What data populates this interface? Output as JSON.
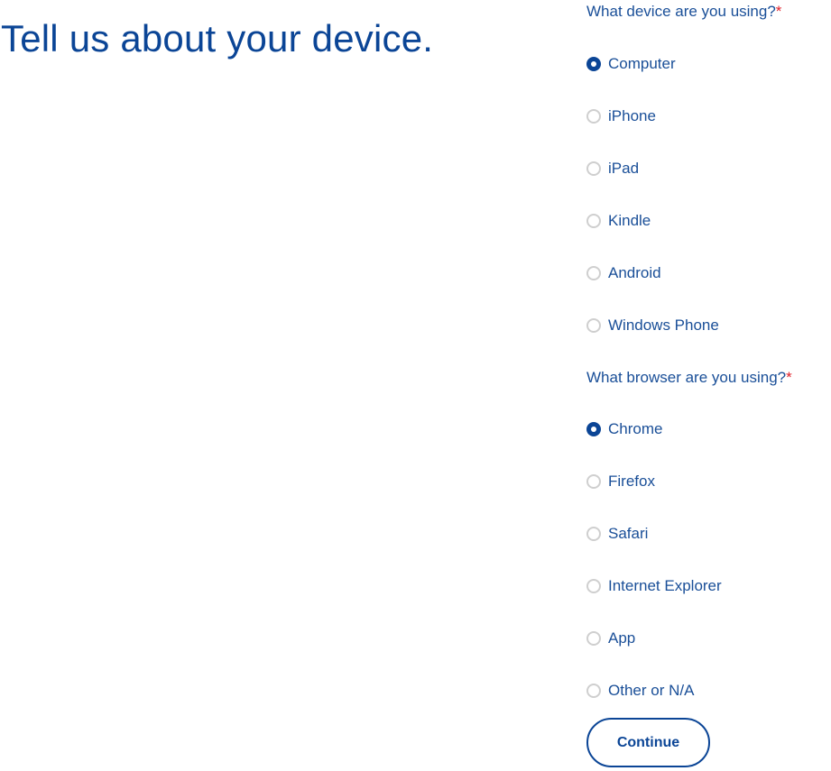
{
  "page": {
    "title": "Tell us about your device."
  },
  "device_question": {
    "label": "What device are you using?",
    "required_marker": "*",
    "selected": "Computer",
    "options": [
      {
        "label": "Computer",
        "checked": true
      },
      {
        "label": "iPhone",
        "checked": false
      },
      {
        "label": "iPad",
        "checked": false
      },
      {
        "label": "Kindle",
        "checked": false
      },
      {
        "label": "Android",
        "checked": false
      },
      {
        "label": "Windows Phone",
        "checked": false
      }
    ]
  },
  "browser_question": {
    "label": "What browser are you using?",
    "required_marker": "*",
    "selected": "Chrome",
    "options": [
      {
        "label": "Chrome",
        "checked": true
      },
      {
        "label": "Firefox",
        "checked": false
      },
      {
        "label": "Safari",
        "checked": false
      },
      {
        "label": "Internet Explorer",
        "checked": false
      },
      {
        "label": "App",
        "checked": false
      },
      {
        "label": "Other or N/A",
        "checked": false
      }
    ]
  },
  "actions": {
    "continue_label": "Continue"
  },
  "colors": {
    "primary": "#0b4596",
    "text": "#1a4f98",
    "required": "#e0202a",
    "radio_unchecked_border": "#cfcfcf"
  }
}
